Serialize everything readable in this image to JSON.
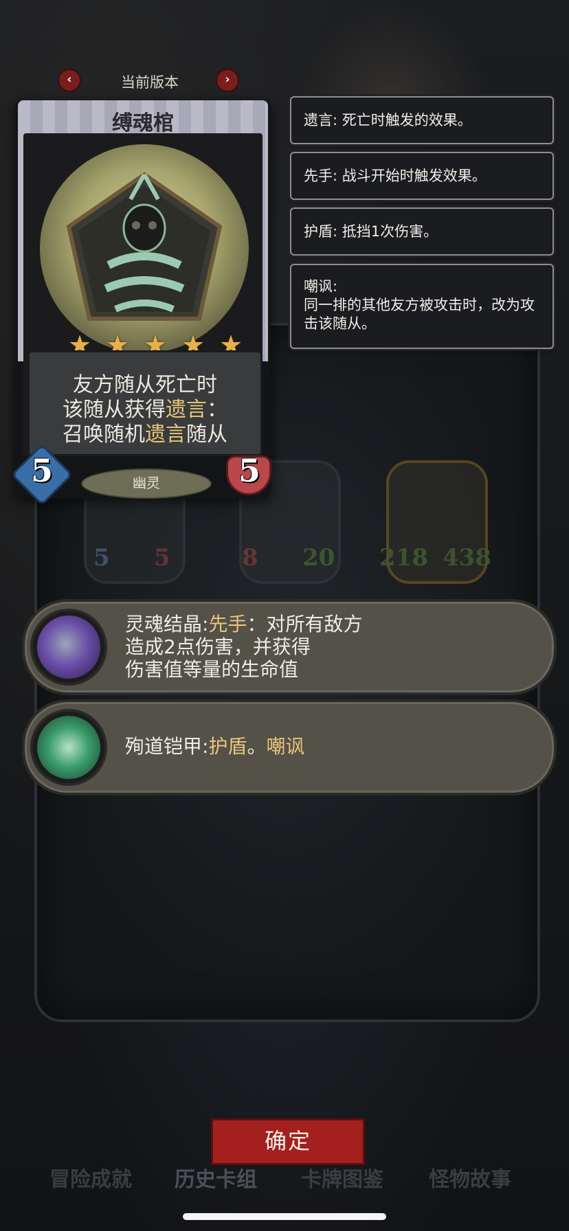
{
  "version": {
    "label": "当前版本",
    "prev_icon": "chevron-left-icon",
    "next_icon": "chevron-right-icon"
  },
  "card": {
    "name": "缚魂棺",
    "stars": 5,
    "description": {
      "line1": "友方随从死亡时",
      "line2_pre": "该随从获得",
      "line2_hl": "遗言",
      "line2_post": "：",
      "line3_pre": "召唤随机",
      "line3_hl": "遗言",
      "line3_post": "随从"
    },
    "cost": "5",
    "health": "5",
    "race": "幽灵"
  },
  "keywords": [
    {
      "text": "遗言: 死亡时触发的效果。"
    },
    {
      "text": "先手: 战斗开始时触发效果。"
    },
    {
      "text": "护盾: 抵挡1次伤害。"
    },
    {
      "title": "嘲讽:",
      "text": "同一排的其他友方被攻击时，改为攻击该随从。"
    }
  ],
  "minions": [
    {
      "attack": "5",
      "health": "5"
    },
    {
      "attack": "8",
      "health": "20"
    },
    {
      "attack": "218",
      "health": "438"
    }
  ],
  "abilities": [
    {
      "name": "灵魂结晶:",
      "kw": "先手",
      "line1_rest": "：对所有敌方",
      "line2": "造成2点伤害，并获得",
      "line3": "伤害值等量的生命值",
      "icon": "soul-crystal-icon"
    },
    {
      "name": "殉道铠甲:",
      "kw1": "护盾",
      "sep": "。",
      "kw2": "嘲讽",
      "icon": "martyr-armor-icon"
    }
  ],
  "confirm_label": "确定",
  "tabs": [
    "冒险成就",
    "历史卡组",
    "卡牌图鉴",
    "怪物故事"
  ],
  "colors": {
    "highlight": "#e8c67a",
    "confirm": "#a3201e",
    "cost": "#3a6ea8",
    "health": "#b8484c"
  }
}
